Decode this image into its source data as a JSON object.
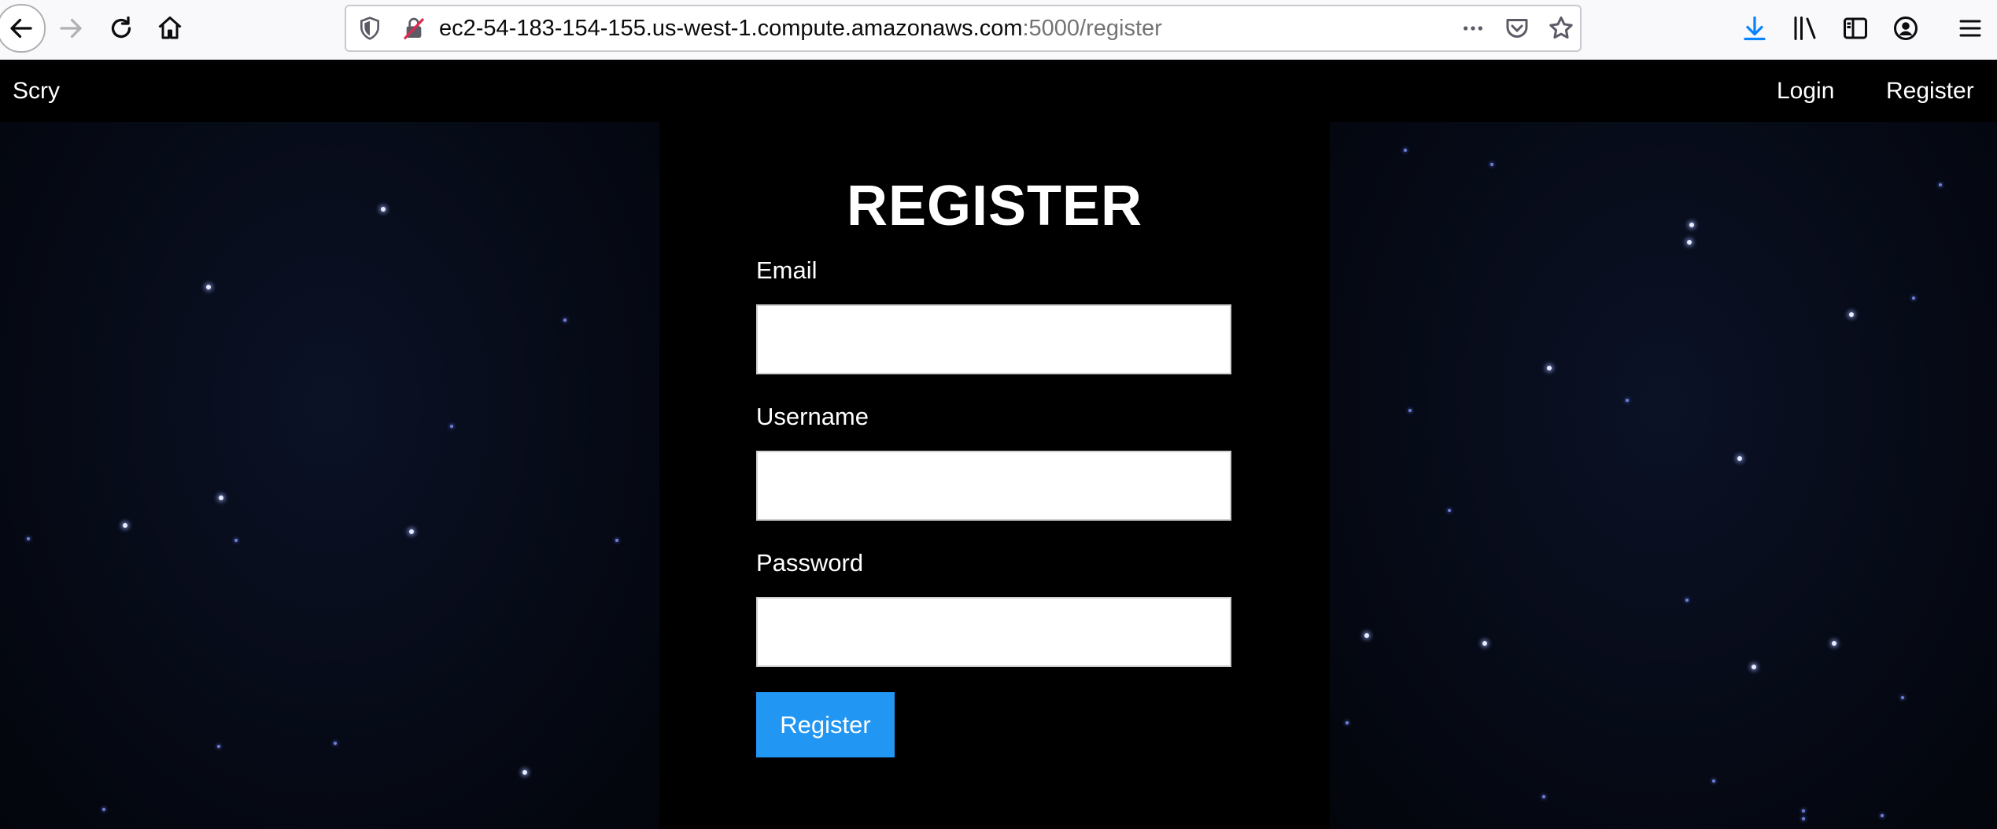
{
  "browser": {
    "url_host": "ec2-54-183-154-155.us-west-1.compute.amazonaws.com",
    "url_path": ":5000/register",
    "icons": [
      "back-icon",
      "forward-icon",
      "reload-icon",
      "home-icon",
      "shield-icon",
      "insecure-lock-icon",
      "more-icon",
      "pocket-icon",
      "bookmark-star-icon",
      "download-icon",
      "library-icon",
      "sidebar-icon",
      "account-icon",
      "menu-icon"
    ],
    "accent_color": "#0a84ff"
  },
  "nav": {
    "brand": "Scry",
    "login": "Login",
    "register": "Register"
  },
  "form": {
    "title": "REGISTER",
    "email_label": "Email",
    "email_value": "",
    "username_label": "Username",
    "username_value": "",
    "password_label": "Password",
    "password_value": "",
    "submit_label": "Register",
    "submit_color": "#2196f3"
  }
}
